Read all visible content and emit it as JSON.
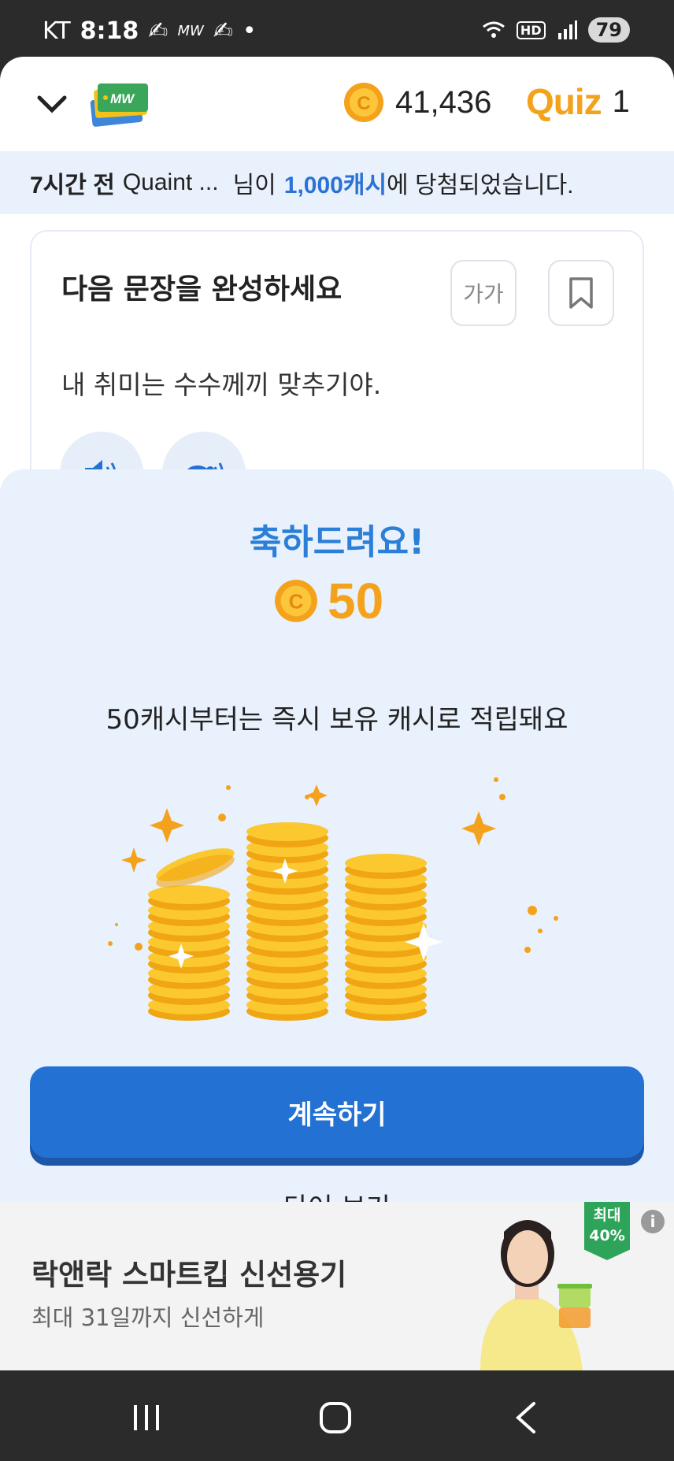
{
  "status_bar": {
    "carrier": "KT",
    "time": "8:18",
    "notif_text": "MW",
    "hd_label": "HD",
    "battery": "79"
  },
  "header": {
    "coin_balance": "41,436",
    "quiz_logo": "Quiz",
    "quiz_count": "1"
  },
  "ticker": {
    "time_ago": "7시간 전",
    "user": "Quaint ...",
    "text_mid": "님이",
    "amount": "1,000캐시",
    "text_end": "에 당첨되었습니다."
  },
  "quiz": {
    "title": "다음 문장을 완성하세요",
    "font_button": "가가",
    "sentence": "내 취미는 수수께끼 맞추기야."
  },
  "reward_sheet": {
    "congrats": "축하드려요!",
    "amount": "50",
    "info": "50캐시부터는 즉시 보유 캐시로 적립돼요",
    "continue_label": "계속하기",
    "words_label": "단어 보기"
  },
  "ad": {
    "title": "락앤락 스마트킵 신선용기",
    "subtitle": "최대 31일까지 신선하게",
    "badge_line1": "최대",
    "badge_line2": "40%",
    "info_glyph": "i"
  },
  "colors": {
    "accent_blue": "#2471d4",
    "coin_gold": "#f4a21b",
    "sheet_bg": "#e8f1fc"
  }
}
